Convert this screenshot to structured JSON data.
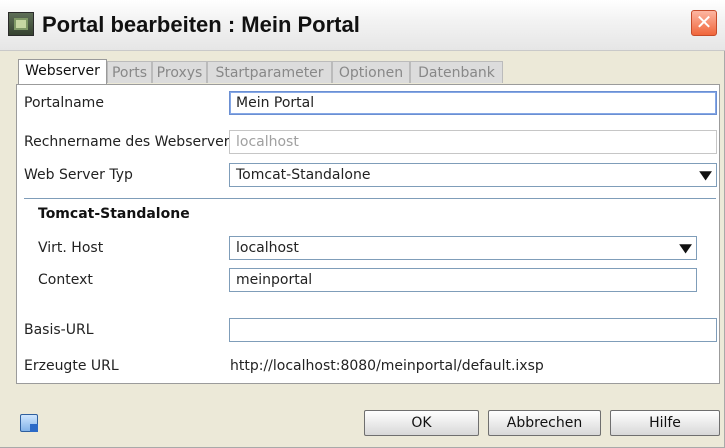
{
  "window": {
    "title": "Portal bearbeiten : Mein Portal",
    "title_icon": "portal-window-icon",
    "close_glyph": "✕"
  },
  "tabs": [
    {
      "label": "Webserver",
      "active": true
    },
    {
      "label": "Ports",
      "active": false
    },
    {
      "label": "Proxys",
      "active": false
    },
    {
      "label": "Startparameter",
      "active": false
    },
    {
      "label": "Optionen",
      "active": false
    },
    {
      "label": "Datenbank",
      "active": false
    }
  ],
  "form": {
    "portalname_label": "Portalname",
    "portalname_value": "Mein Portal",
    "rechnername_label": "Rechnername des Webservers",
    "rechnername_value": "localhost",
    "web_server_typ_label": "Web Server Typ",
    "web_server_typ_value": "Tomcat-Standalone",
    "tomcat_group_title": "Tomcat-Standalone",
    "virt_host_label": "Virt. Host",
    "virt_host_value": "localhost",
    "context_label": "Context",
    "context_value": "meinportal",
    "basis_url_label": "Basis-URL",
    "basis_url_value": "",
    "erzeugte_url_label": "Erzeugte URL",
    "erzeugte_url_value": "http://localhost:8080/meinportal/default.ixsp"
  },
  "footer": {
    "help_icon": "window-help-icon",
    "ok_label": "OK",
    "cancel_label": "Abbrechen",
    "hilfe_label": "Hilfe"
  }
}
